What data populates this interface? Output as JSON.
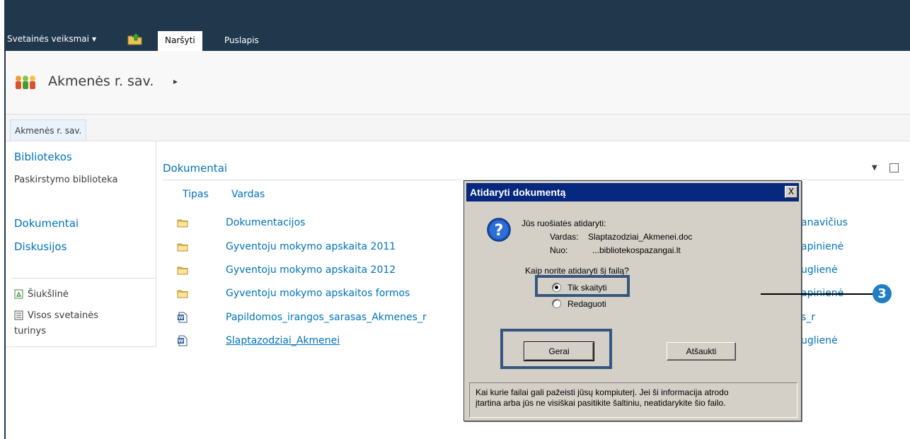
{
  "ribbon": {
    "site_actions_label": "Svetainės veiksmai",
    "tabs": [
      {
        "label": "Naršyti",
        "active": true
      },
      {
        "label": "Puslapis",
        "active": false
      }
    ]
  },
  "site": {
    "title": "Akmenės r. sav.",
    "top_link": "Akmenės r. sav."
  },
  "quicklaunch": {
    "libraries_heading": "Bibliotekos",
    "libraries_sub": "Paskirstymo biblioteka",
    "documents": "Dokumentai",
    "discussions": "Diskusijos",
    "recycle_bin": "Šiukšlinė",
    "all_content_line1": "Visos svetainės",
    "all_content_line2": "turinys"
  },
  "list": {
    "title": "Dokumentai",
    "columns": {
      "type": "Tipas",
      "name": "Vardas"
    },
    "rows": [
      {
        "type": "folder",
        "name": "Dokumentacijos",
        "author": "anavičius"
      },
      {
        "type": "folder",
        "name": "Gyventoju mokymo apskaita 2011",
        "author": "apinienė"
      },
      {
        "type": "folder",
        "name": "Gyventoju mokymo apskaita 2012",
        "author": "uglienė"
      },
      {
        "type": "folder",
        "name": "Gyventoju mokymo apskaitos formos",
        "author": "apinienė"
      },
      {
        "type": "word-doc",
        "name": "Papildomos_irangos_sarasas_Akmenes_r",
        "author": "s_r"
      },
      {
        "type": "word-doc",
        "name": "Slaptazodziai_Akmenei",
        "author": "uglienė"
      }
    ]
  },
  "dialog": {
    "title": "Atidaryti dokumentą",
    "close_label": "X",
    "intro": "Jūs ruošiatės atidaryti:",
    "name_label": "Vardas:",
    "name_value": "Slaptazodziai_Akmenei.doc",
    "from_label": "Nuo:",
    "from_value": "...bibliotekospazangai.lt",
    "question": "Kaip norite atidaryti šį failą?",
    "options": [
      {
        "label": "Tik skaityti",
        "checked": true
      },
      {
        "label": "Redaguoti",
        "checked": false
      }
    ],
    "ok_label": "Gerai",
    "cancel_label": "Atšaukti",
    "warning_line1": "Kai kurie failai gali pažeisti jūsų kompiuterį. Jei ši informacija atrodo",
    "warning_line2": "įtartina arba jūs ne visiškai pasitikite šaltiniu, neatidarykite šio failo."
  },
  "annotation": {
    "callout_number": "3"
  },
  "colors": {
    "ribbon_bg": "#21374c",
    "link_blue": "#0072bc",
    "dialog_title_bg": "#06287f",
    "dialog_bg": "#d4d0c8",
    "highlight_border": "#35577f",
    "callout_badge": "#1f7ec5"
  }
}
